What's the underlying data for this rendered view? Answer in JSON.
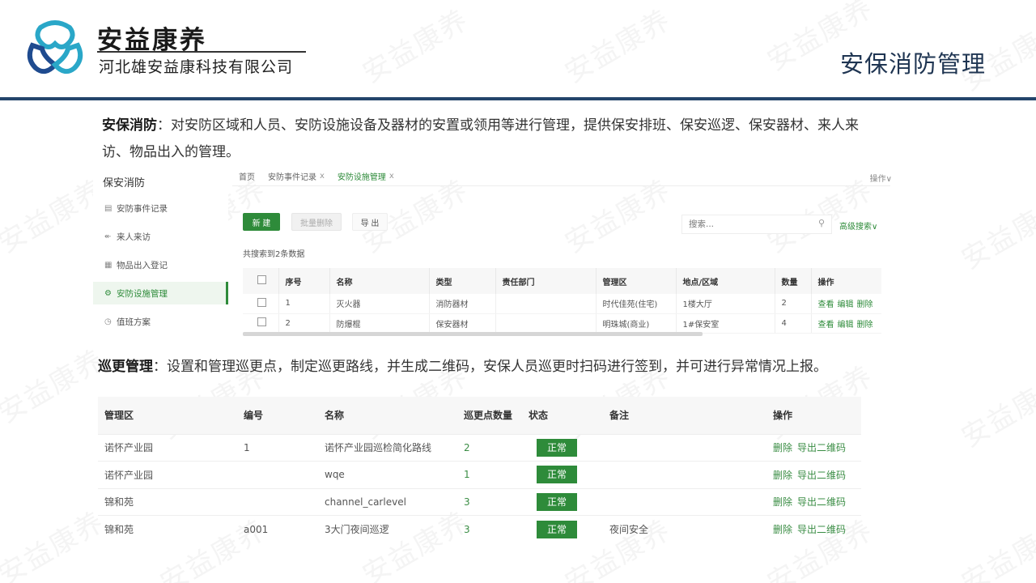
{
  "header": {
    "brand_name": "安益康养",
    "brand_sub": "河北雄安益康科技有限公司",
    "page_title": "安保消防管理",
    "watermark": "安益康养"
  },
  "colors": {
    "accent_green": "#2e8b3a",
    "header_rule": "#24456b",
    "title_color": "#1f3552"
  },
  "intro": {
    "label": "安保消防",
    "text": "：对安防区域和人员、安防设施设备及器材的安置或领用等进行管理，提供保安排班、保安巡逻、保安器材、来人来访、物品出入的管理。"
  },
  "app": {
    "sidebar": {
      "title": "保安消防",
      "items": [
        {
          "label": "安防事件记录",
          "icon": "file-icon"
        },
        {
          "label": "来人来访",
          "icon": "arrow-icon"
        },
        {
          "label": "物品出入登记",
          "icon": "doc-icon"
        },
        {
          "label": "安防设施管理",
          "icon": "settings-icon",
          "active": true
        },
        {
          "label": "值班方案",
          "icon": "clock-icon"
        }
      ]
    },
    "tabs": [
      {
        "label": "首页",
        "closable": false
      },
      {
        "label": "安防事件记录",
        "closable": true
      },
      {
        "label": "安防设施管理",
        "closable": true,
        "active": true
      }
    ],
    "tab_close": "x",
    "tab_operation": "操作∨",
    "toolbar": {
      "new_label": "新 建",
      "batch_delete_label": "批量删除",
      "export_label": "导 出"
    },
    "search": {
      "placeholder": "搜索...",
      "advanced_label": "高级搜索∨"
    },
    "result_count": "共搜索到2条数据",
    "table": {
      "columns": [
        "",
        "序号",
        "名称",
        "类型",
        "责任部门",
        "管理区",
        "地点/区域",
        "数量",
        "操作"
      ],
      "rows": [
        {
          "index": "1",
          "name": "灭火器",
          "type": "消防器材",
          "dept": "",
          "area": "时代佳苑(住宅)",
          "location": "1楼大厅",
          "qty": "2"
        },
        {
          "index": "2",
          "name": "防爆棍",
          "type": "保安器材",
          "dept": "",
          "area": "明珠城(商业)",
          "location": "1#保安室",
          "qty": "4"
        }
      ],
      "row_actions": [
        "查看",
        "编辑",
        "删除"
      ]
    }
  },
  "patrol": {
    "label": "巡更管理",
    "text": "：设置和管理巡更点，制定巡更路线，并生成二维码，安保人员巡更时扫码进行签到，并可进行异常情况上报。"
  },
  "route_table": {
    "columns": [
      "管理区",
      "编号",
      "名称",
      "巡更点数量",
      "状态",
      "备注",
      "操作"
    ],
    "rows": [
      {
        "area": "诺怀产业园",
        "code": "1",
        "name": "诺怀产业园巡检简化路线",
        "points": "2",
        "status": "正常",
        "remark": ""
      },
      {
        "area": "诺怀产业园",
        "code": "",
        "name": "wqe",
        "points": "1",
        "status": "正常",
        "remark": ""
      },
      {
        "area": "锦和苑",
        "code": "",
        "name": "channel_carlevel",
        "points": "3",
        "status": "正常",
        "remark": ""
      },
      {
        "area": "锦和苑",
        "code": "a001",
        "name": "3大门夜间巡逻",
        "points": "3",
        "status": "正常",
        "remark": "夜间安全"
      }
    ],
    "row_actions": [
      "删除",
      "导出二维码"
    ]
  }
}
